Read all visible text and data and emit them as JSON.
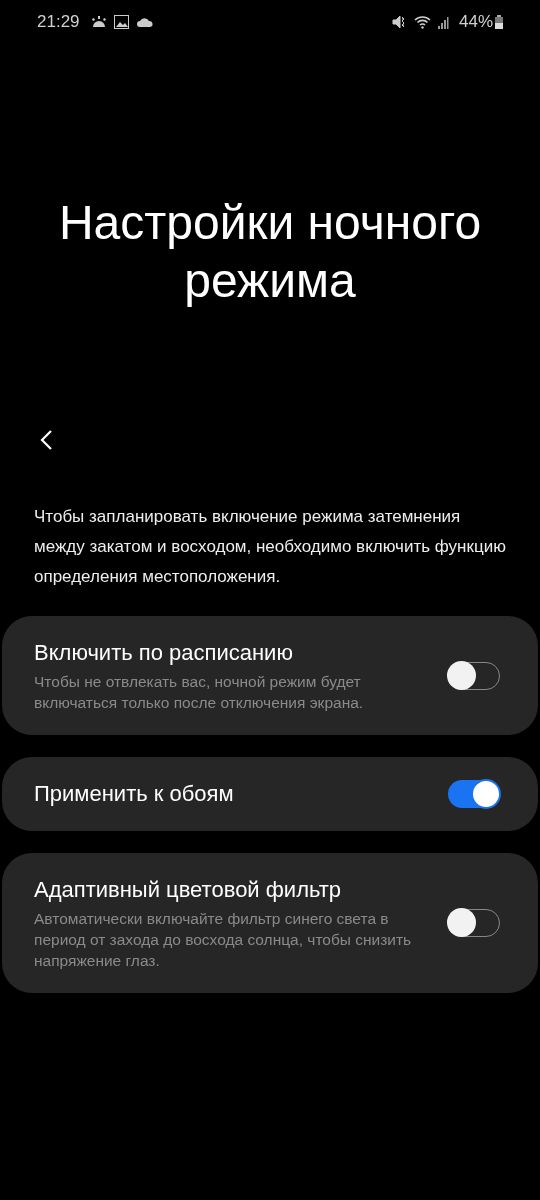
{
  "status_bar": {
    "time": "21:29",
    "battery": "44%"
  },
  "title": "Настройки ночного режима",
  "description": "Чтобы запланировать включение режима затемнения между закатом и восходом, необходимо включить функцию определения местоположения.",
  "settings": [
    {
      "title": "Включить по расписанию",
      "subtitle": "Чтобы не отвлекать вас, ночной режим будет включаться только после отключения экрана.",
      "on": false
    },
    {
      "title": "Применить к обоям",
      "on": true
    },
    {
      "title": "Адаптивный цветовой фильтр",
      "subtitle": "Автоматически включайте фильтр синего света в период от захода до восхода солнца, чтобы снизить напряжение глаз.",
      "on": false
    }
  ]
}
